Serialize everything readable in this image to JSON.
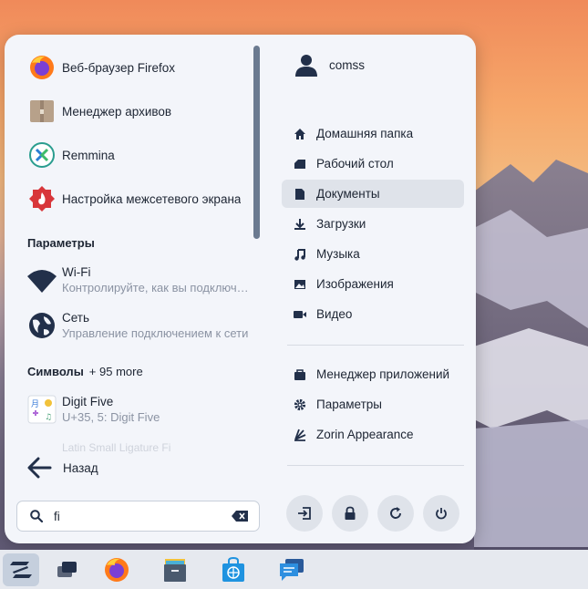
{
  "apps": [
    {
      "label": "Веб-браузер Firefox",
      "icon": "firefox-icon"
    },
    {
      "label": "Менеджер архивов",
      "icon": "archive-manager-icon"
    },
    {
      "label": "Remmina",
      "icon": "remmina-icon"
    },
    {
      "label": "Настройка межсетевого экрана",
      "icon": "firewall-icon"
    }
  ],
  "sections": {
    "settings": "Параметры",
    "symbols": "Символы",
    "symbols_more": "+ 95 more"
  },
  "settings_results": [
    {
      "title": "Wi-Fi",
      "desc": "Контролируйте, как вы подключаетесь к сетям Wi-Fi",
      "icon": "wifi-icon"
    },
    {
      "title": "Сеть",
      "desc": "Управление подключением к сети",
      "icon": "network-icon"
    }
  ],
  "symbols_results": [
    {
      "title": "Digit Five",
      "desc": "U+35, 5: Digit Five",
      "icon": "character-map-icon"
    }
  ],
  "faded_item": "Latin Small Ligature Fi",
  "back_label": "Назад",
  "search": {
    "value": "fi"
  },
  "user": {
    "name": "comss"
  },
  "places": [
    {
      "label": "Домашняя папка",
      "icon": "home-icon"
    },
    {
      "label": "Рабочий стол",
      "icon": "desktop-icon"
    },
    {
      "label": "Документы",
      "icon": "documents-icon",
      "active": true
    },
    {
      "label": "Загрузки",
      "icon": "downloads-icon"
    },
    {
      "label": "Музыка",
      "icon": "music-icon"
    },
    {
      "label": "Изображения",
      "icon": "pictures-icon"
    },
    {
      "label": "Видео",
      "icon": "video-icon"
    }
  ],
  "system": [
    {
      "label": "Менеджер приложений",
      "icon": "software-icon"
    },
    {
      "label": "Параметры",
      "icon": "settings-icon"
    },
    {
      "label": "Zorin Appearance",
      "icon": "appearance-icon"
    }
  ],
  "power": [
    "logout-icon",
    "lock-icon",
    "restart-icon",
    "power-icon"
  ],
  "taskbar": [
    "zorin-menu-icon",
    "workspaces-icon",
    "firefox-icon",
    "files-icon",
    "software-store-icon",
    "chat-icon"
  ],
  "colors": {
    "menu_bg": "#f3f5fa",
    "text": "#1d2533",
    "muted": "#8b93a3",
    "active": "#dfe3ea",
    "icon_dark": "#22304a"
  }
}
